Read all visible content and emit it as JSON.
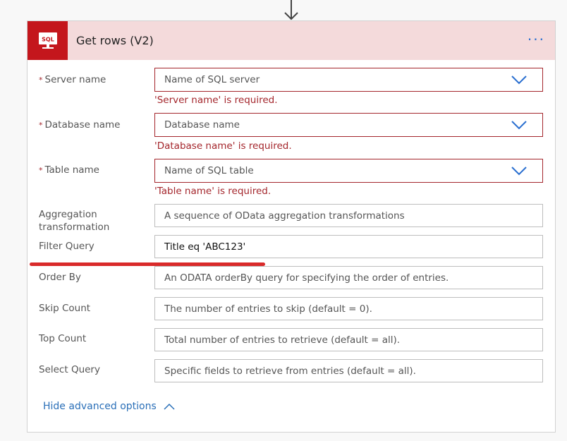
{
  "action": {
    "title": "Get rows (V2)",
    "icon_text": "SQL",
    "more_label": "···",
    "header_color": "#f4dadb",
    "icon_color": "#c4161c"
  },
  "fields": [
    {
      "label": "Server name",
      "required": true,
      "placeholder": "Name of SQL server",
      "error": "'Server name' is required."
    },
    {
      "label": "Database name",
      "required": true,
      "placeholder": "Database name",
      "error": "'Database name' is required."
    },
    {
      "label": "Table name",
      "required": true,
      "placeholder": "Name of SQL table",
      "error": "'Table name' is required."
    },
    {
      "label": "Aggregation transformation",
      "placeholder": "A sequence of OData aggregation transformations"
    },
    {
      "label": "Filter Query",
      "value": "Title eq 'ABC123'"
    },
    {
      "label": "Order By",
      "placeholder": "An ODATA orderBy query for specifying the order of entries."
    },
    {
      "label": "Skip Count",
      "placeholder": "The number of entries to skip (default = 0)."
    },
    {
      "label": "Top Count",
      "placeholder": "Total number of entries to retrieve (default = all)."
    },
    {
      "label": "Select Query",
      "placeholder": "Specific fields to retrieve from entries (default = all)."
    }
  ],
  "required_marker": "*",
  "hide_advanced": "Hide advanced options"
}
